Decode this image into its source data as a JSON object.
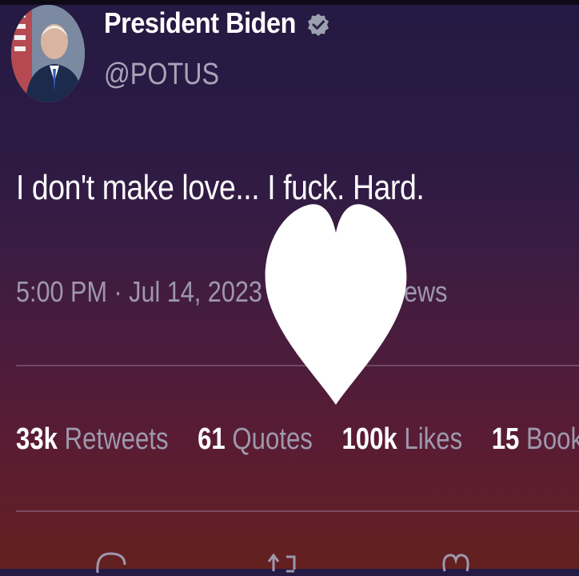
{
  "tweet": {
    "author_name": "President Biden",
    "handle": "@POTUS",
    "text": "I don't make love... I fuck. Hard.",
    "time_date": "5:00 PM · Jul 14, 2023",
    "views_fragment": "ews",
    "stats": [
      {
        "number": "33k",
        "label": "Retweets"
      },
      {
        "number": "61",
        "label": "Quotes"
      },
      {
        "number": "100k",
        "label": "Likes"
      },
      {
        "number": "15",
        "label": "Book"
      }
    ]
  },
  "icons": {
    "verified": "verified-badge-icon",
    "heart_overlay": "heart-icon",
    "reply": "reply-icon",
    "retweet": "retweet-icon",
    "like": "like-icon"
  },
  "colors": {
    "primary_text": "#ffffff",
    "secondary_text": "#9e98ad",
    "background_top": "#241a43",
    "background_bottom": "#63201f"
  }
}
